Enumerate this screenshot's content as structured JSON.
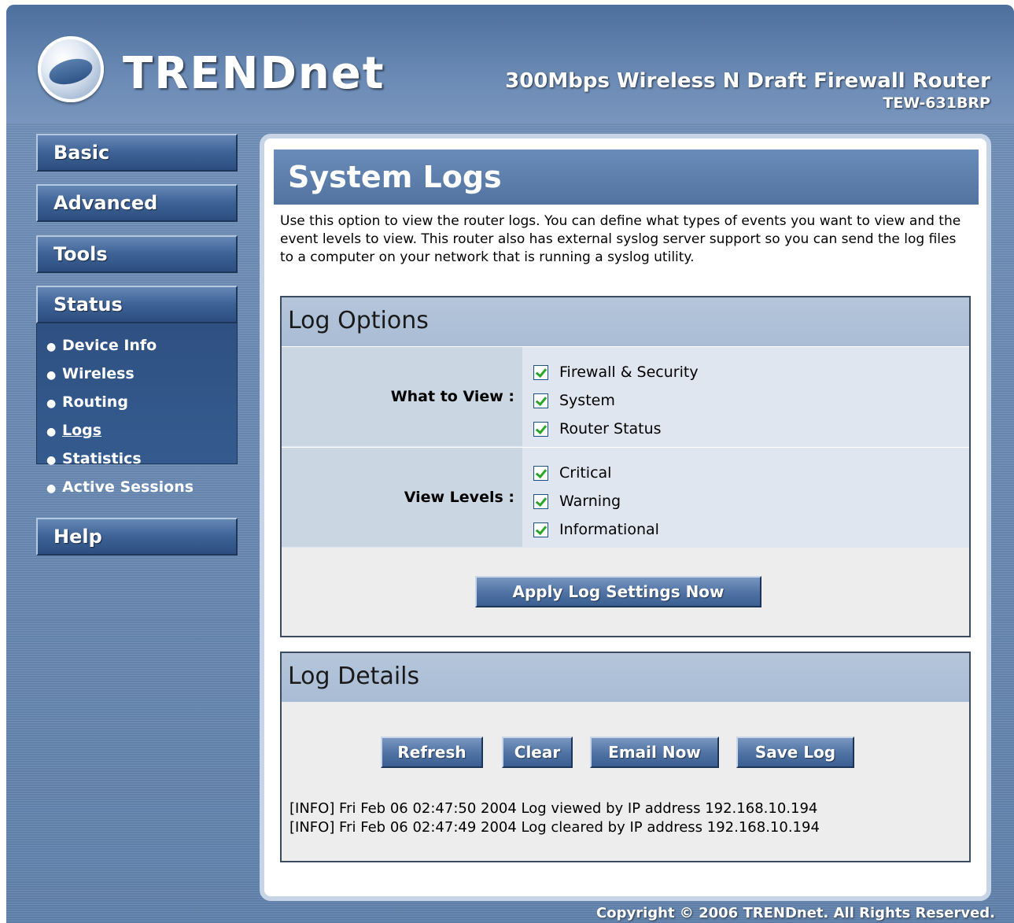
{
  "header": {
    "brand": "TRENDnet",
    "product": "300Mbps Wireless N Draft Firewall Router",
    "model": "TEW-631BRP"
  },
  "nav": {
    "basic": "Basic",
    "advanced": "Advanced",
    "tools": "Tools",
    "status": "Status",
    "help": "Help",
    "status_items": [
      "Device Info",
      "Wireless",
      "Routing",
      "Logs",
      "Statistics",
      "Active Sessions"
    ],
    "active_item": "Logs"
  },
  "page": {
    "title": "System Logs",
    "intro": "Use this option to view the router logs. You can define what types of events you want to view and the event levels to view. This router also has external syslog server support so you can send the log files to a computer on your network that is running a syslog utility."
  },
  "log_options": {
    "heading": "Log Options",
    "what_to_view_label": "What to View :",
    "what_to_view": [
      {
        "label": "Firewall & Security",
        "checked": true
      },
      {
        "label": "System",
        "checked": true
      },
      {
        "label": "Router Status",
        "checked": true
      }
    ],
    "view_levels_label": "View Levels :",
    "view_levels": [
      {
        "label": "Critical",
        "checked": true
      },
      {
        "label": "Warning",
        "checked": true
      },
      {
        "label": "Informational",
        "checked": true
      }
    ],
    "apply_button": "Apply Log Settings Now"
  },
  "log_details": {
    "heading": "Log Details",
    "buttons": {
      "refresh": "Refresh",
      "clear": "Clear",
      "email": "Email Now",
      "save": "Save Log"
    },
    "entries": [
      "[INFO] Fri Feb 06 02:47:50 2004 Log viewed by IP address 192.168.10.194",
      "[INFO] Fri Feb 06 02:47:49 2004 Log cleared by IP address 192.168.10.194"
    ]
  },
  "footer": {
    "copyright": "Copyright © 2006 TRENDnet. All Rights Reserved."
  },
  "colors": {
    "frame_blue": "#5d7ea8",
    "title_bar": "#52739f",
    "check_green": "#2aa52a"
  }
}
